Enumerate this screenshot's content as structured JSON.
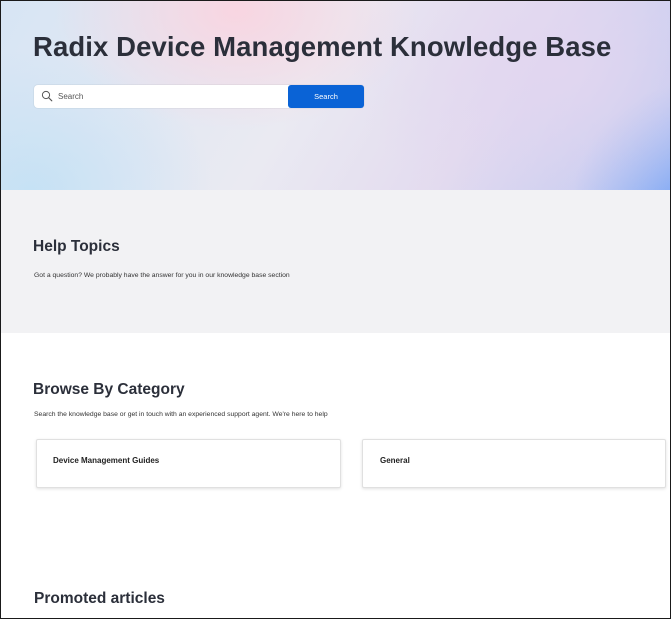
{
  "hero": {
    "title": "Radix Device Management Knowledge Base",
    "search": {
      "placeholder": "Search",
      "value": "",
      "button_label": "Search",
      "icon": "search-icon"
    },
    "button_color": "#0a63d6"
  },
  "help_topics": {
    "title": "Help Topics",
    "subtitle": "Got a question? We probably have the answer for you in our knowledge base section"
  },
  "browse": {
    "title": "Browse By Category",
    "subtitle": "Search the knowledge base or get in touch with an experienced support agent. We're here to help",
    "categories": [
      {
        "label": "Device Management Guides"
      },
      {
        "label": "General"
      }
    ]
  },
  "promoted": {
    "title": "Promoted articles"
  }
}
